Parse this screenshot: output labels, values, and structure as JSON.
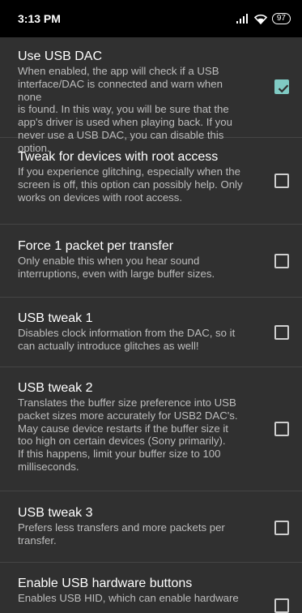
{
  "status_bar": {
    "time": "3:13 PM",
    "battery": "97",
    "icons": [
      "signal-icon",
      "wifi-icon",
      "battery-icon"
    ]
  },
  "colors": {
    "background": "#303030",
    "accent": "#80cbc4",
    "summary": "#bdbdbd"
  },
  "settings": [
    {
      "title": "Use USB DAC",
      "summary_lines": [
        "When enabled, the app will check if a USB",
        "interface/DAC is connected and warn when none",
        "is found. In this way, you will be sure that the",
        "app's driver is used when playing back. If you",
        "never use a USB DAC, you can disable this option."
      ],
      "checked": true
    },
    {
      "title": "Tweak for devices with root access",
      "summary_lines": [
        "If you experience glitching, especially when the",
        "screen is off, this option can possibly help. Only",
        "works on devices with root access."
      ],
      "checked": false
    },
    {
      "title": "Force 1 packet per transfer",
      "summary_lines": [
        "Only enable this when you hear sound",
        "interruptions, even with large buffer sizes."
      ],
      "checked": false
    },
    {
      "title": "USB tweak 1",
      "summary_lines": [
        "Disables clock information from the DAC, so it",
        "can actually introduce glitches as well!"
      ],
      "checked": false
    },
    {
      "title": "USB tweak 2",
      "summary_lines": [
        "Translates the buffer size preference into USB",
        "packet sizes more accurately for USB2 DAC's.",
        "May cause device restarts if the buffer size it",
        "too high on certain devices (Sony primarily).",
        "If this happens, limit your buffer size to 100",
        "milliseconds."
      ],
      "checked": false
    },
    {
      "title": "USB tweak 3",
      "summary_lines": [
        "Prefers less transfers and more packets per",
        "transfer."
      ],
      "checked": false
    },
    {
      "title": "Enable USB hardware buttons",
      "summary_lines": [
        "Enables USB HID, which can enable hardware"
      ],
      "checked": false
    }
  ]
}
